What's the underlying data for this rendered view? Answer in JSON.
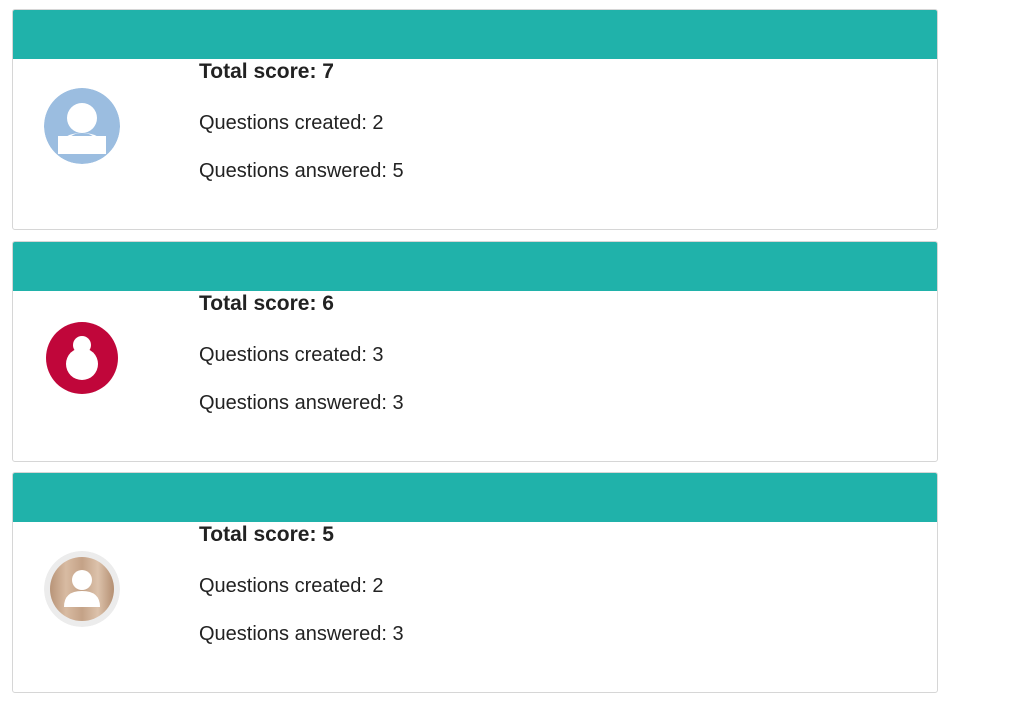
{
  "leaderboard": {
    "entries": [
      {
        "score_label": "Total score: 7",
        "created_label": "Questions created: 2",
        "answered_label": "Questions answered: 5",
        "avatar_icon": "default-user-avatar-icon",
        "avatar_color": "#9bbde0"
      },
      {
        "score_label": "Total score: 6",
        "created_label": "Questions created: 3",
        "answered_label": "Questions answered: 3",
        "avatar_icon": "red-user-avatar-icon",
        "avatar_color": "#c0063a"
      },
      {
        "score_label": "Total score: 5",
        "created_label": "Questions created: 2",
        "answered_label": "Questions answered: 3",
        "avatar_icon": "wood-user-avatar-icon",
        "avatar_color": "#c9a88e"
      }
    ],
    "header_color": "#20b2aa"
  }
}
